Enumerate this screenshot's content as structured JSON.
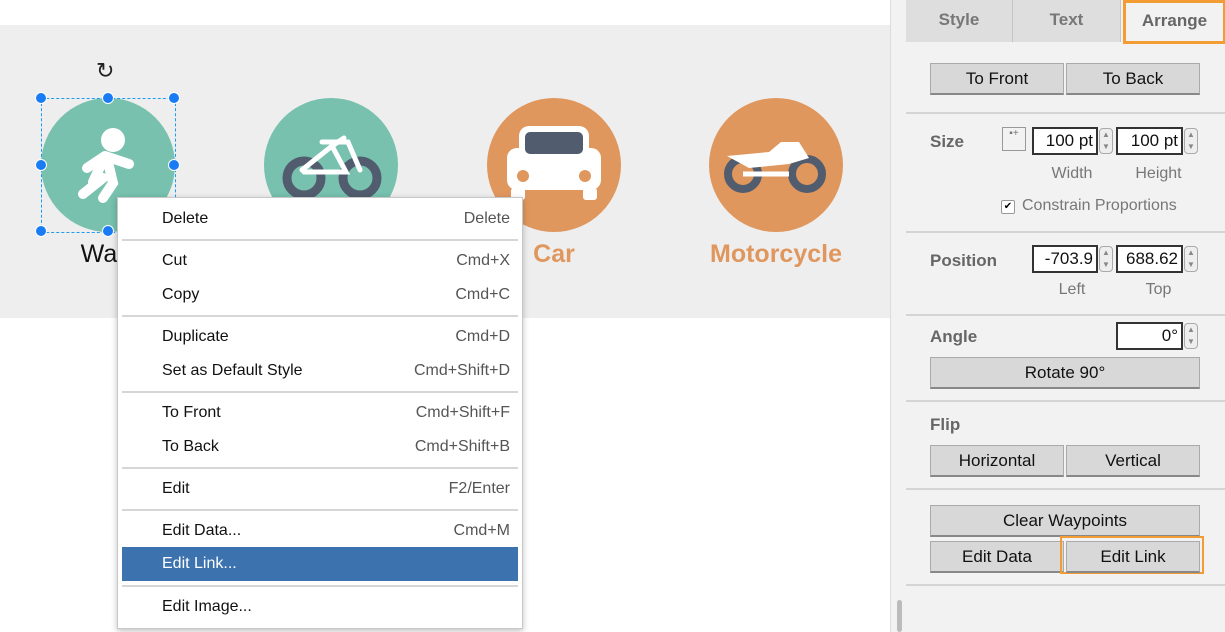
{
  "canvas": {
    "shapes": [
      {
        "label": "Walk",
        "color": "#77c1ae",
        "label_color": "#111111",
        "icon": "walking-person-icon"
      },
      {
        "label": "",
        "color": "#77c1ae",
        "label_color": "#e0975e",
        "icon": "bicycle-icon"
      },
      {
        "label": "Car",
        "color": "#e0975e",
        "label_color": "#e0975e",
        "icon": "car-icon"
      },
      {
        "label": "Motorcycle",
        "color": "#e0975e",
        "label_color": "#e0975e",
        "icon": "motorcycle-icon"
      }
    ]
  },
  "context_menu": {
    "items": [
      {
        "label": "Delete",
        "shortcut": "Delete"
      },
      {
        "label": "Cut",
        "shortcut": "Cmd+X"
      },
      {
        "label": "Copy",
        "shortcut": "Cmd+C"
      },
      {
        "label": "Duplicate",
        "shortcut": "Cmd+D"
      },
      {
        "label": "Set as Default Style",
        "shortcut": "Cmd+Shift+D"
      },
      {
        "label": "To Front",
        "shortcut": "Cmd+Shift+F"
      },
      {
        "label": "To Back",
        "shortcut": "Cmd+Shift+B"
      },
      {
        "label": "Edit",
        "shortcut": "F2/Enter"
      },
      {
        "label": "Edit Data...",
        "shortcut": "Cmd+M"
      },
      {
        "label": "Edit Link...",
        "shortcut": "",
        "highlighted": true
      },
      {
        "label": "Edit Image...",
        "shortcut": ""
      }
    ]
  },
  "panel": {
    "tabs": [
      "Style",
      "Text",
      "Arrange"
    ],
    "active_tab": "Arrange",
    "to_front": "To Front",
    "to_back": "To Back",
    "size": {
      "label": "Size",
      "width": "100 pt",
      "height": "100 pt",
      "width_label": "Width",
      "height_label": "Height",
      "constrain": "Constrain Proportions",
      "constrain_checked": true
    },
    "position": {
      "label": "Position",
      "left": "-703.9",
      "top": "688.62",
      "left_label": "Left",
      "top_label": "Top"
    },
    "angle": {
      "label": "Angle",
      "value": "0°",
      "rotate": "Rotate 90°"
    },
    "flip": {
      "label": "Flip",
      "horizontal": "Horizontal",
      "vertical": "Vertical"
    },
    "clear_waypoints": "Clear Waypoints",
    "edit_data": "Edit Data",
    "edit_link": "Edit Link"
  },
  "highlight_color": "#f39c34"
}
